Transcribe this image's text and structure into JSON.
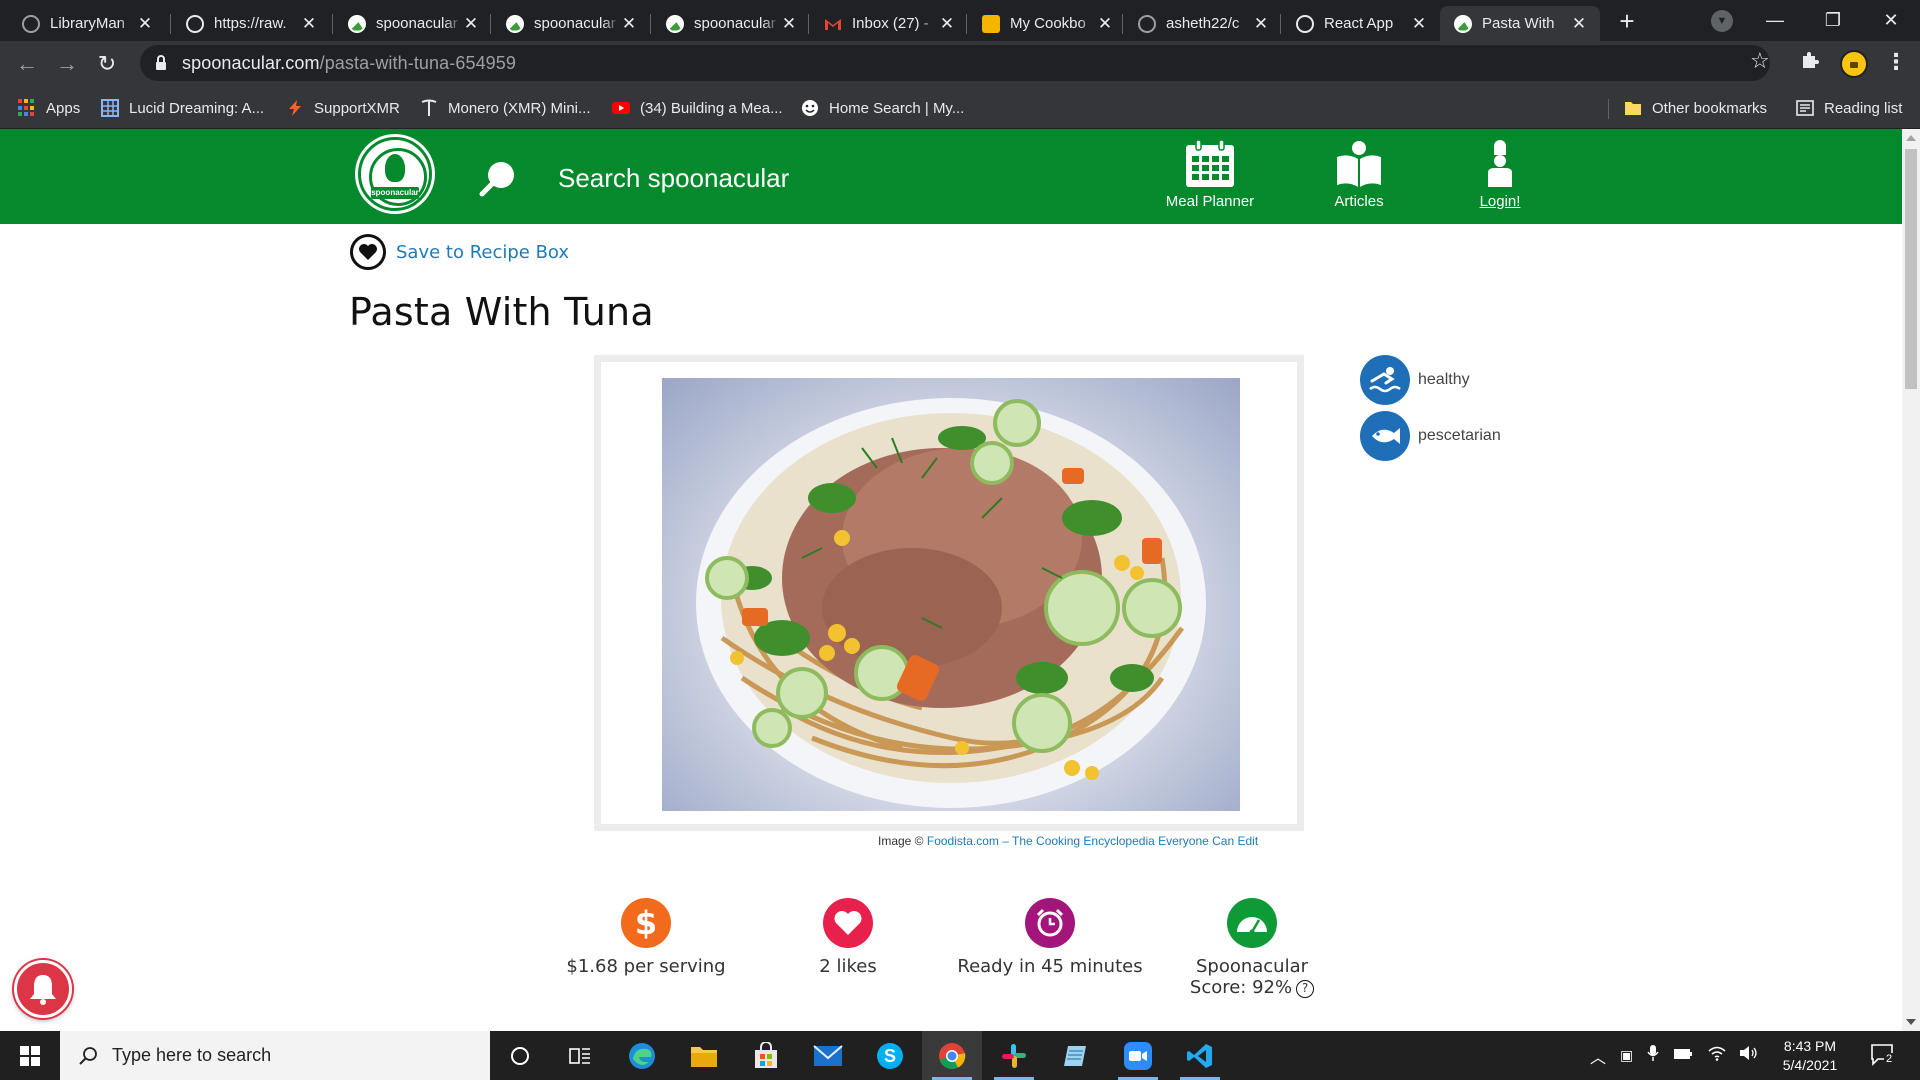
{
  "browser": {
    "tabs": [
      {
        "title": "LibraryMan",
        "favicon": "github-icon"
      },
      {
        "title": "https://raw.",
        "favicon": "globe-icon"
      },
      {
        "title": "spoonacular",
        "favicon": "spoonacular-icon"
      },
      {
        "title": "spoonacular",
        "favicon": "spoonacular-icon"
      },
      {
        "title": "spoonacular",
        "favicon": "spoonacular-icon"
      },
      {
        "title": "Inbox (27) -",
        "favicon": "gmail-icon"
      },
      {
        "title": "My Cookbo",
        "favicon": "slides-icon"
      },
      {
        "title": "asheth22/c",
        "favicon": "github-icon"
      },
      {
        "title": "React App",
        "favicon": "globe-icon"
      },
      {
        "title": "Pasta With",
        "favicon": "spoonacular-icon",
        "active": true
      }
    ],
    "url_domain": "spoonacular.com",
    "url_path": "/pasta-with-tuna-654959",
    "bookmarks": [
      {
        "label": "Apps",
        "icon": "apps-grid-icon"
      },
      {
        "label": "Lucid Dreaming: A...",
        "icon": "calendar-grid-icon"
      },
      {
        "label": "SupportXMR",
        "icon": "lightning-icon"
      },
      {
        "label": "Monero (XMR) Mini...",
        "icon": "pickaxe-icon"
      },
      {
        "label": "(34) Building a Mea...",
        "icon": "youtube-icon"
      },
      {
        "label": "Home Search | My...",
        "icon": "smiley-icon"
      }
    ],
    "other_bookmarks": "Other bookmarks",
    "reading_list": "Reading list"
  },
  "site": {
    "logo_text": "spoonacular",
    "search_placeholder": "Search spoonacular",
    "nav": {
      "meal_planner": "Meal Planner",
      "articles": "Articles",
      "login": "Login!"
    }
  },
  "recipe": {
    "save_label": "Save to Recipe Box",
    "title": "Pasta With Tuna",
    "image_credit_prefix": "Image ©",
    "image_credit_link": "Foodista.com – The Cooking Encyclopedia Everyone Can Edit",
    "diets": [
      {
        "label": "healthy",
        "icon": "healthy-swimmer-icon"
      },
      {
        "label": "pescetarian",
        "icon": "fish-icon"
      }
    ],
    "stats": {
      "price": "$1.68 per serving",
      "likes": "2 likes",
      "ready": "Ready in 45 minutes",
      "score_label": "Spoonacular",
      "score_value": "Score: 92%"
    }
  },
  "colors": {
    "brand_green": "#04892c",
    "link_blue": "#1e7ab8",
    "diet_blue": "#1e6fb8",
    "price_orange": "#f26a1b",
    "likes_red": "#e8214c",
    "time_purple": "#a3157b",
    "score_green": "#0f9a38"
  },
  "taskbar": {
    "search_placeholder": "Type here to search",
    "time": "8:43 PM",
    "date": "5/4/2021",
    "notification_count": "2"
  }
}
